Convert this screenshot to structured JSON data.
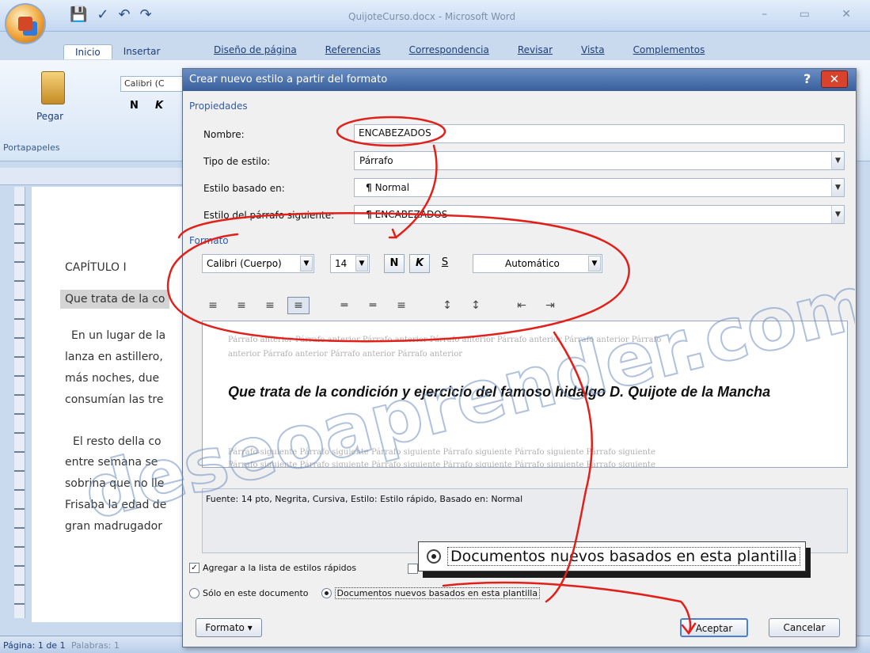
{
  "window": {
    "title": "QuijoteCurso.docx - Microsoft Word",
    "tabs": [
      "Inicio",
      "Insertar",
      "Diseño de página",
      "Referencias",
      "Correspondencia",
      "Revisar",
      "Vista",
      "Complementos"
    ]
  },
  "ribbon": {
    "font_name": "Calibri (C",
    "paste_label": "Pegar",
    "clipboard_group": "Portapapeles"
  },
  "document": {
    "lines": [
      "CAPÍTULO I",
      "Que trata de la co",
      "En un lugar de la",
      "lanza en astillero,",
      "más noches, due",
      "consumían las tre",
      "El resto della co",
      "entre semana se",
      "sobrina que no lle",
      "Frisaba la edad de",
      "gran madrugador"
    ]
  },
  "status": {
    "page": "Página: 1 de 1",
    "words": "Palabras: 1"
  },
  "dialog": {
    "title": "Crear nuevo estilo a partir del formato",
    "help_icon": "?",
    "close_icon": "✕",
    "properties_label": "Propiedades",
    "name_label": "Nombre:",
    "name_value": "ENCABEZADOS",
    "type_label": "Tipo de estilo:",
    "type_value": "Párrafo",
    "based_label": "Estilo basado en:",
    "based_value": "Normal",
    "next_label": "Estilo del párrafo siguiente:",
    "next_value": "ENCABEZADOS",
    "format_label": "Formato",
    "font_value": "Calibri (Cuerpo)",
    "size_value": "14",
    "bold_label": "N",
    "italic_label": "K",
    "underline_label": "S",
    "color_value": "Automático",
    "preview_prev_1": "Párrafo anterior Párrafo anterior Párrafo anterior Párrafo anterior Párrafo anterior Párrafo anterior Párrafo",
    "preview_prev_2": "anterior Párrafo anterior Párrafo anterior Párrafo anterior",
    "preview_main": "Que trata de la condición y ejercicio del famoso hidalgo D. Quijote de la Mancha",
    "preview_next_1": "Párrafo siguiente Párrafo siguiente Párrafo siguiente Párrafo siguiente Párrafo siguiente Párrafo siguiente",
    "preview_next_2": "Párrafo siguiente Párrafo siguiente Párrafo siguiente Párrafo siguiente Párrafo siguiente Párrafo siguiente",
    "description": "Fuente: 14 pto, Negrita, Cursiva, Estilo: Estilo rápido, Basado en: Normal",
    "add_quick_styles": "Agregar a la lista de estilos rápidos",
    "only_this_doc": "Sólo en este documento",
    "new_docs": "Documentos nuevos basados en esta plantilla",
    "format_button": "Formato",
    "ok_button": "Aceptar",
    "cancel_button": "Cancelar"
  },
  "callout": {
    "text": "Documentos nuevos basados en esta plantilla"
  },
  "watermark": {
    "text": "deseoaprender.com"
  }
}
